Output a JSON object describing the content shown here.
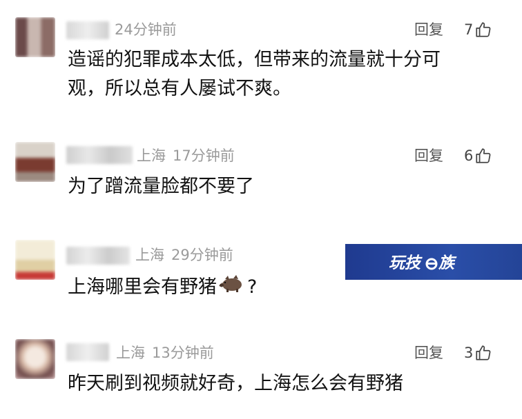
{
  "reply_label": "回复",
  "comments": [
    {
      "location": "",
      "time": "24分钟前",
      "likes": "7",
      "text_lines": [
        "造谣的犯罪成本太低，但带来的流量就十分可",
        "观，所以总有人屡试不爽。"
      ]
    },
    {
      "location": "上海",
      "time": "17分钟前",
      "likes": "6",
      "text_lines": [
        "为了蹭流量脸都不要了"
      ]
    },
    {
      "location": "上海",
      "time": "29分钟前",
      "likes": "",
      "text_before_emoji": "上海哪里会有野猪",
      "emoji": "boar-icon",
      "text_after_emoji": "?"
    },
    {
      "location": "上海",
      "time": "13分钟前",
      "likes": "3",
      "text_lines": [
        "昨天刷到视频就好奇，上海怎么会有野猪"
      ]
    }
  ],
  "watermark": {
    "text": "玩技e族",
    "colors": {
      "background": "#244497",
      "text": "#ffffff"
    }
  },
  "icons": {
    "like": "thumbs-up-icon",
    "emoji": "boar-icon"
  }
}
